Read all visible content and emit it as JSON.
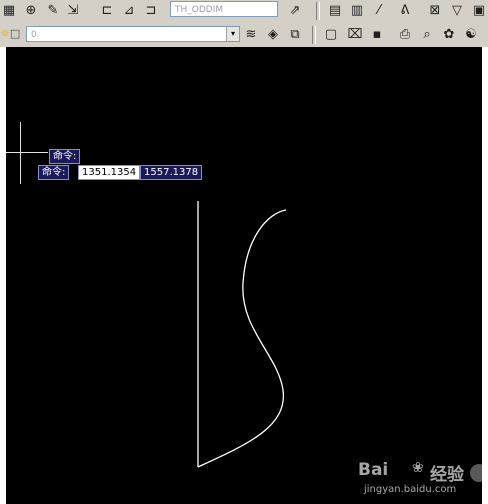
{
  "toolbar": {
    "style_combo_value": "TH_ODDIM",
    "layer_combo_value": "0"
  },
  "canvas": {
    "tooltip_label": "命令:",
    "input_label": "命令:",
    "coord_x": "1351.1354",
    "coord_y": "1557.1378"
  },
  "watermark": {
    "brand": "Bai",
    "brand_cn": "经验",
    "site": "jingyan.baidu.com"
  },
  "colors": {
    "canvas": "#000000",
    "toolbar": "#d4d0c8",
    "tooltip_bg": "#1a1a5a"
  }
}
